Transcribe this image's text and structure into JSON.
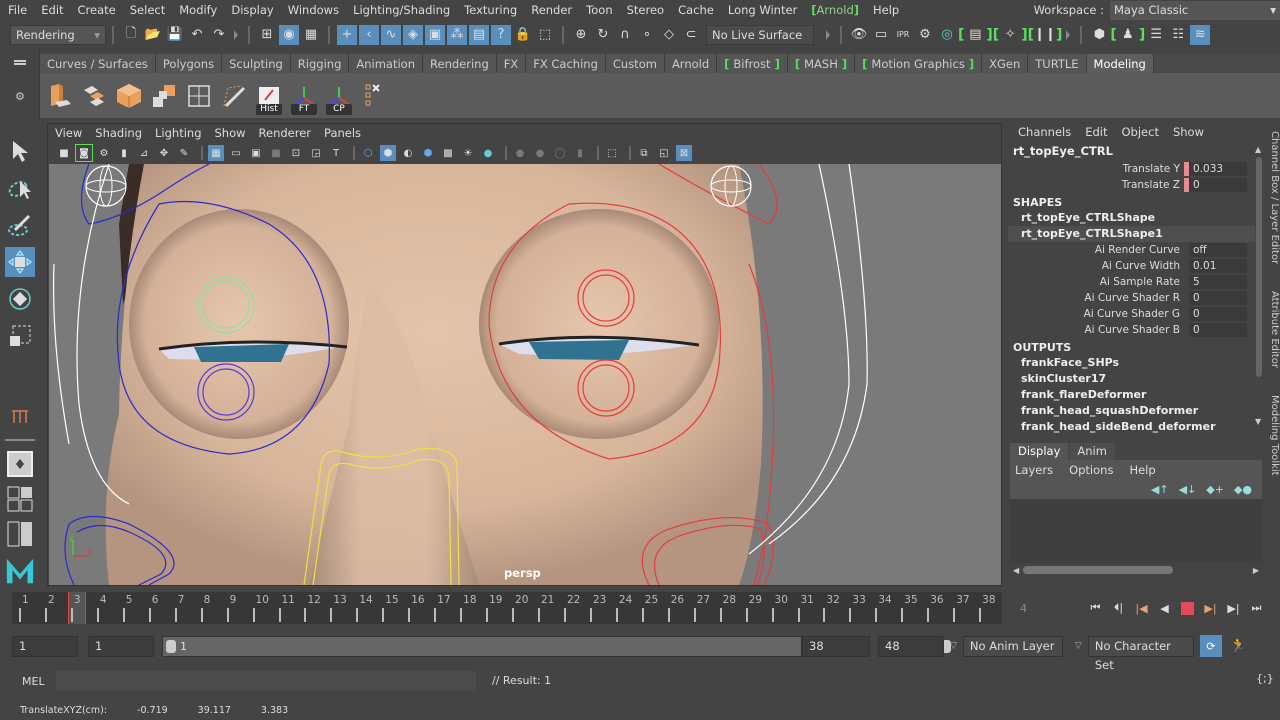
{
  "menubar": {
    "items": [
      "File",
      "Edit",
      "Create",
      "Select",
      "Modify",
      "Display",
      "Windows",
      "Lighting/Shading",
      "Texturing",
      "Render",
      "Toon",
      "Stereo",
      "Cache",
      "Long Winter",
      "Arnold",
      "Help"
    ],
    "workspace_label": "Workspace :",
    "workspace_value": "Maya Classic"
  },
  "statusline": {
    "menuset": "Rendering",
    "live_surface": "No Live Surface"
  },
  "shelf": {
    "tabs": [
      "Curves / Surfaces",
      "Polygons",
      "Sculpting",
      "Rigging",
      "Animation",
      "Rendering",
      "FX",
      "FX Caching",
      "Custom",
      "Arnold",
      "Bifrost",
      "MASH",
      "Motion Graphics",
      "XGen",
      "TURTLE",
      "Modeling"
    ],
    "active_tab": "Modeling",
    "button_tags": [
      "Hist",
      "FT",
      "CP"
    ]
  },
  "viewport": {
    "menus": [
      "View",
      "Shading",
      "Lighting",
      "Show",
      "Renderer",
      "Panels"
    ],
    "camera_label": "persp"
  },
  "channelbox": {
    "menus": [
      "Channels",
      "Edit",
      "Object",
      "Show"
    ],
    "object": "rt_topEye_CTRL",
    "attributes": [
      {
        "name": "Translate Y",
        "value": "0.033",
        "keyed": true
      },
      {
        "name": "Translate Z",
        "value": "0",
        "keyed": true
      }
    ],
    "shapes_header": "SHAPES",
    "shapes": [
      "rt_topEye_CTRLShape",
      "rt_topEye_CTRLShape1"
    ],
    "shape_attributes": [
      {
        "name": "Ai Render Curve",
        "value": "off"
      },
      {
        "name": "Ai Curve Width",
        "value": "0.01"
      },
      {
        "name": "Ai Sample Rate",
        "value": "5"
      },
      {
        "name": "Ai Curve Shader R",
        "value": "0"
      },
      {
        "name": "Ai Curve Shader G",
        "value": "0"
      },
      {
        "name": "Ai Curve Shader B",
        "value": "0"
      }
    ],
    "outputs_header": "OUTPUTS",
    "outputs": [
      "frankFace_SHPs",
      "skinCluster17",
      "frank_flareDeformer",
      "frank_head_squashDeformer",
      "frank_head_sideBend_deformer"
    ]
  },
  "side_tabs": [
    "Channel Box / Layer Editor",
    "Attribute Editor",
    "Modeling Toolkit"
  ],
  "layer_editor": {
    "tabs": [
      "Display",
      "Anim"
    ],
    "active_tab": "Display",
    "menus": [
      "Layers",
      "Options",
      "Help"
    ]
  },
  "timeline": {
    "start": 1,
    "end": 38,
    "current_frame": 3,
    "current_frame_field": "4",
    "frames": [
      1,
      2,
      3,
      4,
      5,
      6,
      7,
      8,
      9,
      10,
      11,
      12,
      13,
      14,
      15,
      16,
      17,
      18,
      19,
      20,
      21,
      22,
      23,
      24,
      25,
      26,
      27,
      28,
      29,
      30,
      31,
      32,
      33,
      34,
      35,
      36,
      37,
      38
    ]
  },
  "range": {
    "start_field": "1",
    "playback_start": "1",
    "slider_start": "1",
    "slider_end": "38",
    "playback_end": "38",
    "end_field": "48",
    "anim_layer": "No Anim Layer",
    "character_set": "No Character Set"
  },
  "commandline": {
    "language": "MEL",
    "result": "// Result: 1"
  },
  "helpline": {
    "label": "TranslateXYZ(cm):",
    "x": "-0.719",
    "y": "39.117",
    "z": "3.383"
  }
}
